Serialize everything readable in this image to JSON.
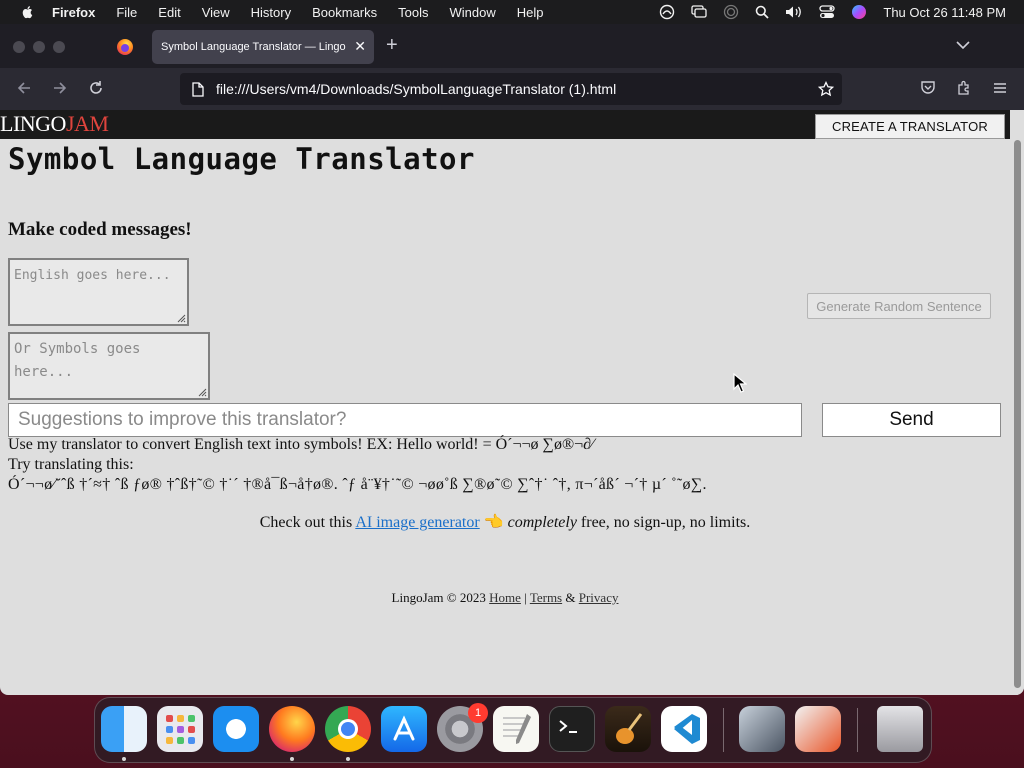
{
  "menubar": {
    "app_name": "Firefox",
    "menus": [
      "File",
      "Edit",
      "View",
      "History",
      "Bookmarks",
      "Tools",
      "Window",
      "Help"
    ],
    "clock": "Thu Oct 26  11:48 PM"
  },
  "browser": {
    "tab_title": "Symbol Language Translator — Lingo",
    "url": "file:///Users/vm4/Downloads/SymbolLanguageTranslator (1).html"
  },
  "page": {
    "logo_lingo": "LINGO",
    "logo_jam": "JAM",
    "create_button": "CREATE A TRANSLATOR",
    "title": "Symbol Language Translator",
    "tagline": "Make coded messages!",
    "english_placeholder": "English goes here...",
    "symbols_placeholder": "Or Symbols goes here...",
    "random_button": "Generate Random Sentence",
    "suggest_placeholder": "Suggestions to improve this translator?",
    "send_button": "Send",
    "intro": "Use my translator to convert English text into symbols! EX: Hello world! = Ó´¬¬ø ∑ø®¬∂⁄",
    "try_label": "Try translating this:",
    "try_sentence": "Ó´¬¬ø⁄˘ˆß †´≈† ˆß ƒø® †ˆß†˜© †˙´ †®å¯ß¬å†ø®. ˆƒ å¨¥†˙˜© ¬øø˚ß ∑®ø˜© ∑ˆ†˙ ˆ†, π¬´åß´ ¬´† µ´ ˚˜ø∑.",
    "promo_prefix": "Check out this",
    "promo_link": "AI image generator",
    "promo_emoji": "👈",
    "promo_emphasis": "completely",
    "promo_suffix": "free, no sign-up, no limits.",
    "footer_text": "LingoJam © 2023",
    "footer_home": "Home",
    "footer_sep": "|",
    "footer_terms": "Terms",
    "footer_amp": "&",
    "footer_privacy": "Privacy"
  },
  "dock": {
    "apps": [
      "finder-icon",
      "launchpad-icon",
      "safari-icon",
      "firefox-icon",
      "chrome-icon",
      "app-store-icon",
      "system-settings-icon",
      "textedit-icon",
      "terminal-icon",
      "garageband-icon",
      "vscode-icon",
      "asphalt-8-icon",
      "asphalt-9-icon",
      "trash-icon"
    ],
    "settings_badge": "1"
  },
  "colors": {
    "logo_accent": "#e0443d",
    "link": "#1a6fc9",
    "page_background": "#dedede",
    "browser_chrome": "#2b2a33"
  }
}
